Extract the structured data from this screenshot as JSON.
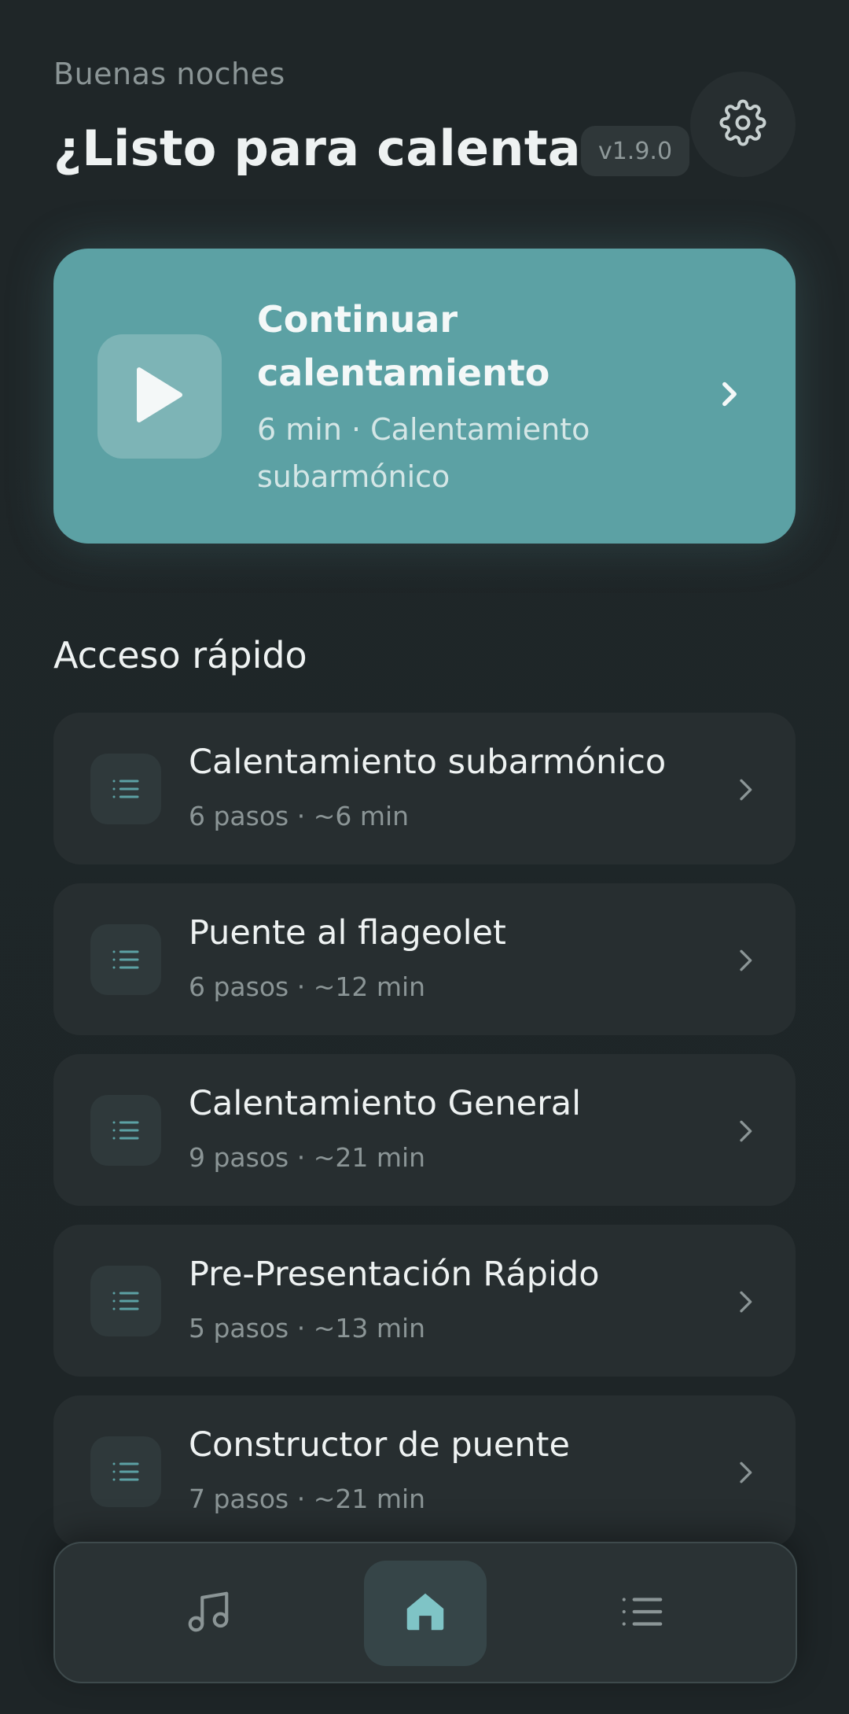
{
  "header": {
    "greeting": "Buenas noches",
    "title": "¿Listo para calentar?",
    "version": "v1.9.0"
  },
  "continue_card": {
    "title": "Continuar calentamiento",
    "subtitle": "6 min · Calentamiento subarmónico"
  },
  "quick_access": {
    "title": "Acceso rápido",
    "items": [
      {
        "title": "Calentamiento subarmónico",
        "meta": "6 pasos · ~6 min"
      },
      {
        "title": "Puente al flageolet",
        "meta": "6 pasos · ~12 min"
      },
      {
        "title": "Calentamiento General",
        "meta": "9 pasos · ~21 min"
      },
      {
        "title": "Pre-Presentación Rápido",
        "meta": "5 pasos · ~13 min"
      },
      {
        "title": "Constructor de puente",
        "meta": "7 pasos · ~21 min"
      }
    ]
  },
  "bottom_nav": {
    "items": [
      {
        "icon": "music-note-icon",
        "active": false
      },
      {
        "icon": "home-icon",
        "active": true
      },
      {
        "icon": "list-icon",
        "active": false
      }
    ]
  },
  "colors": {
    "background": "#1f2628",
    "accent": "#5ca1a4",
    "card": "#272e30",
    "muted_text": "#8b9596"
  }
}
